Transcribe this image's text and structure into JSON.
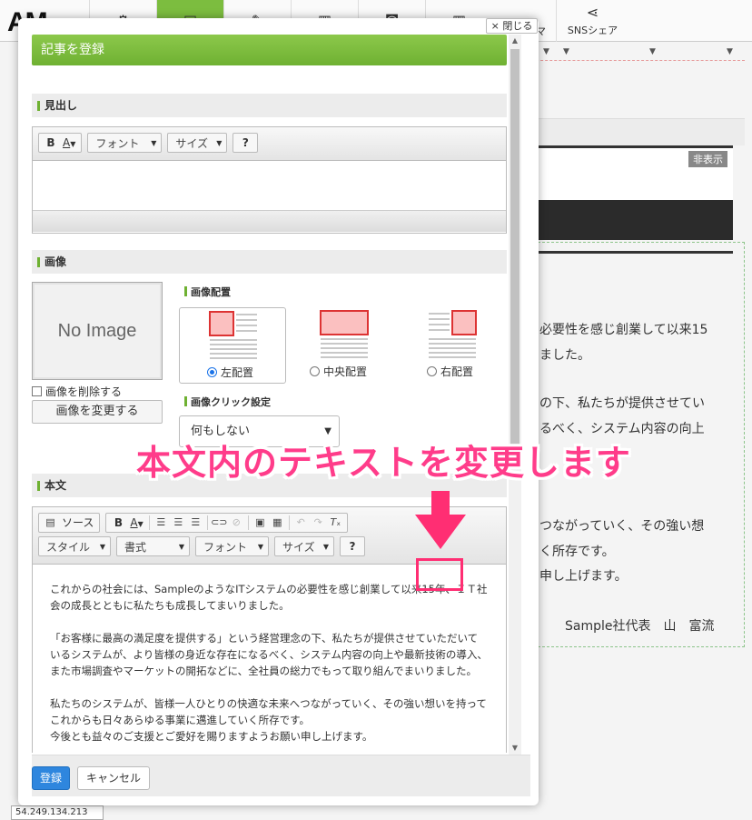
{
  "topbar": {
    "logo": "AM",
    "nav_items": [
      {
        "icon": "gear-icon",
        "label": ""
      },
      {
        "icon": "layout-icon",
        "label": ""
      },
      {
        "icon": "edit-icon",
        "label": ""
      },
      {
        "icon": "document-icon",
        "label": ""
      },
      {
        "icon": "camera-icon",
        "label": ""
      },
      {
        "icon": "theme-icon",
        "label": "マ"
      }
    ],
    "sns_label": "SNSシェア"
  },
  "background": {
    "hidden_badge": "非表示",
    "lines": [
      "必要性を感じ創業して以来15",
      "ました。",
      "の下、私たちが提供させてい",
      "るべく、システム内容の向上",
      "つながっていく、その強い想",
      "く所存です。",
      "申し上げます。",
      "Sample社代表　山　富流"
    ],
    "ip": "54.249.134.213"
  },
  "modal": {
    "close_label": "× 閉じる",
    "title": "記事を登録",
    "heading_section": "見出し",
    "image_section": "画像",
    "body_section": "本文",
    "no_image": "No Image",
    "delete_image": "画像を削除する",
    "change_image": "画像を変更する",
    "placement_label": "画像配置",
    "placement_options": [
      "左配置",
      "中央配置",
      "右配置"
    ],
    "click_label": "画像クリック設定",
    "click_value": "何もしない",
    "toolbar": {
      "bold": "B",
      "color": "A",
      "font": "フォント",
      "size": "サイズ",
      "help": "?",
      "source": "ソース",
      "style": "スタイル",
      "format": "書式"
    },
    "body_paragraphs": [
      "これからの社会には、SampleのようなITシステムの必要性を感じ創業して以来15年、ＩＴ社会の成長とともに私たちも成長してまいりました。",
      "「お客様に最高の満足度を提供する」という経営理念の下、私たちが提供させていただいているシステムが、より皆様の身近な存在になるべく、システム内容の向上や最新技術の導入、また市場調査やマーケットの開拓などに、全社員の総力でもって取り組んでまいりました。",
      "私たちのシステムが、皆様一人ひとりの快適な未来へつながっていく、その強い想いを持ってこれからも日々あらゆる事業に邁進していく所存です。\n今後とも益々のご支援とご愛好を賜りますようお願い申し上げます。"
    ],
    "submit": "登録",
    "cancel": "キャンセル"
  },
  "annotation": {
    "text": "本文内のテキストを変更します",
    "color": "#ff3c8a"
  }
}
